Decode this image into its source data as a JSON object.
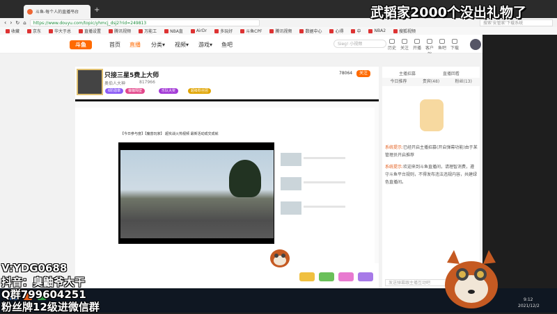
{
  "browser": {
    "tab_title": "斗鱼-每个人的直播平台",
    "url": "https://www.douyu.com/topic/yhmcj_dsj2?rid=249813",
    "right_search": "搜索'安管家'下载系统",
    "bookmarks": [
      "收藏",
      "京东",
      "华大于总",
      "直播设置",
      "腾讯视频",
      "万能工",
      "NBA直",
      "AirDr",
      "多玩好",
      "斗鱼CPF",
      "腾讯视频",
      "数据中心",
      "心得",
      "中",
      "NBA2",
      "搜狐视频"
    ]
  },
  "site": {
    "logo": "斗鱼",
    "nav": [
      "首页",
      "直播",
      "分类▾",
      "视频▾",
      "游戏▾",
      "鱼吧"
    ],
    "search_placeholder": "Sieg! 小视频",
    "top_icons": [
      "历史",
      "关注",
      "开播",
      "客户端",
      "鱼吧",
      "下载"
    ]
  },
  "room": {
    "title": "只接三星5费上大师",
    "follow_count": "78064",
    "follow_label": "关注",
    "fans": "817966",
    "pills": [
      "6阶勋章",
      "偏偏隔壁",
      "乐队大奖",
      "超级粉丝团"
    ],
    "nickname": "奥伯人大神"
  },
  "inner_video": {
    "video_title": "【今日参与度】【魔兽玩家】 超实战火热视频 最新活动成交成就"
  },
  "right_panel": {
    "tabs_top": [
      "主播招募",
      "直播回看"
    ],
    "tabs": [
      "今日推荐",
      "贵宾(48)",
      "粉丝(13)"
    ],
    "chat_lines": [
      {
        "tag": "系统提示:",
        "text": "已经开启主播招募(开启弹幕功能)由于某管理员开启推荐"
      },
      {
        "tag": "系统提示:",
        "text": "欢迎来到斗鱼直播间，请理智消费，遵守斗鱼平台规则，不得发布违法违规内容，共建绿色直播间。"
      }
    ],
    "input_placeholder": "发送弹幕跟主播互动吧"
  },
  "overlay": {
    "banner": "武韬家2000个没出礼物了",
    "lines": [
      "V:YDG0688",
      "抖音：臭鼬爷大干",
      "Q群799604251",
      "粉丝牌12级进微信群"
    ]
  },
  "taskbar": {
    "clock": "9:12",
    "date": "2021/12/2"
  },
  "colors": {
    "accent": "#ff6a00",
    "green": "#1a8a3a",
    "sys": "#e25c1a"
  }
}
